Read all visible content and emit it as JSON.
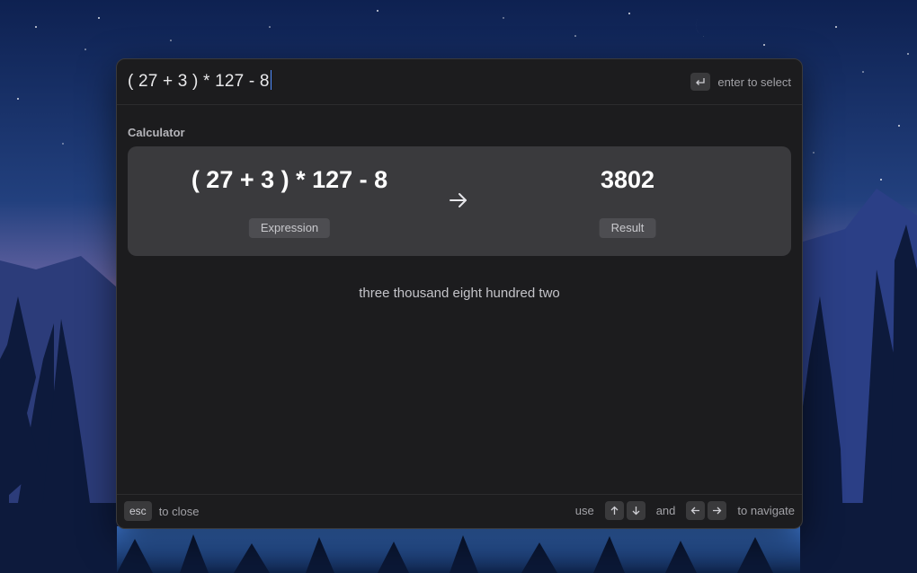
{
  "search": {
    "query": "( 27 + 3 ) * 127 - 8",
    "enter_hint": "enter to select"
  },
  "calculator": {
    "section_title": "Calculator",
    "expression": "( 27 + 3 ) * 127 - 8",
    "expression_label": "Expression",
    "result": "3802",
    "result_label": "Result",
    "result_in_words": "three thousand eight hundred two"
  },
  "footer": {
    "esc_key": "esc",
    "close_hint": "to close",
    "use_label": "use",
    "and_label": "and",
    "navigate_hint": "to navigate"
  },
  "icons": {
    "enter": "return-key-icon",
    "arrow": "arrow-right-icon",
    "up": "arrow-up-icon",
    "down": "arrow-down-icon",
    "left": "arrow-left-icon",
    "right": "arrow-right-icon"
  },
  "colors": {
    "window_bg": "#1c1c1e",
    "card_bg": "#3a3a3d",
    "caret": "#4f8cff"
  }
}
